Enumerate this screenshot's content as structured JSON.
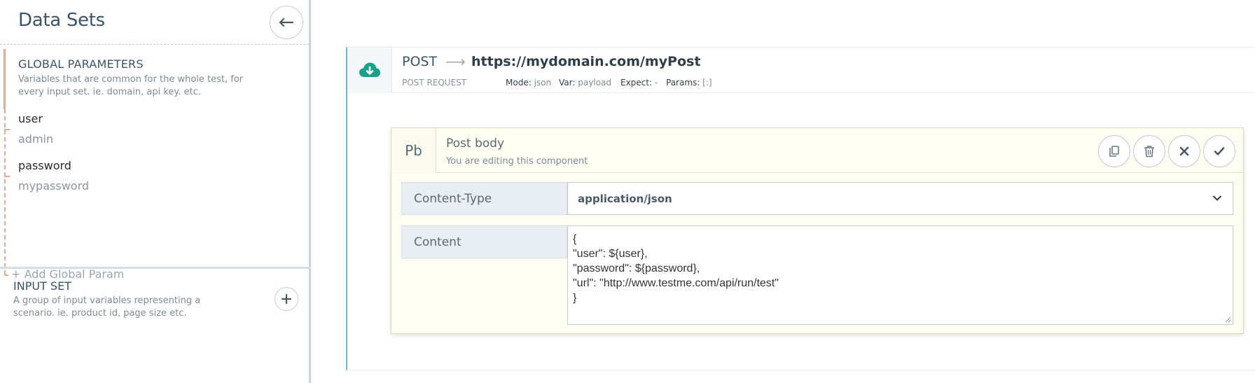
{
  "sidebar": {
    "title": "Data Sets",
    "collapse_icon": "arrow-left-icon",
    "global": {
      "title": "GLOBAL PARAMETERS",
      "description": "Variables that are common for the whole test, for every input set. ie. domain, api key. etc.",
      "params": [
        {
          "name": "user",
          "value": "admin"
        },
        {
          "name": "password",
          "value": "mypassword"
        }
      ],
      "add_label": "+ Add Global Param"
    },
    "input_set": {
      "title": "INPUT SET",
      "description": "A group of input variables representing a scenario. ie. product id, page size etc.",
      "add_icon": "plus-icon"
    }
  },
  "request": {
    "icon": "cloud-download-icon",
    "method": "POST",
    "arrow": "⟶",
    "url": "https://mydomain.com/myPost",
    "subtitle": "POST REQUEST",
    "meta": {
      "mode_label": "Mode:",
      "mode_value": "json",
      "var_label": "Var:",
      "var_value": "payload",
      "expect_label": "Expect:",
      "expect_value": "-",
      "params_label": "Params:",
      "params_value": "[:]"
    },
    "accent_color": "#6fb6c6"
  },
  "component": {
    "badge": "Pb",
    "title": "Post body",
    "subtitle": "You are editing this component",
    "actions": [
      "copy-icon",
      "trash-icon",
      "close-icon",
      "check-icon"
    ],
    "content_type_label": "Content-Type",
    "content_type_value": "application/json",
    "content_label": "Content",
    "content_value": "{\n\"user\": ${user},\n\"password\": ${password},\n\"url\": \"http://www.testme.com/api/run/test\"\n}"
  }
}
